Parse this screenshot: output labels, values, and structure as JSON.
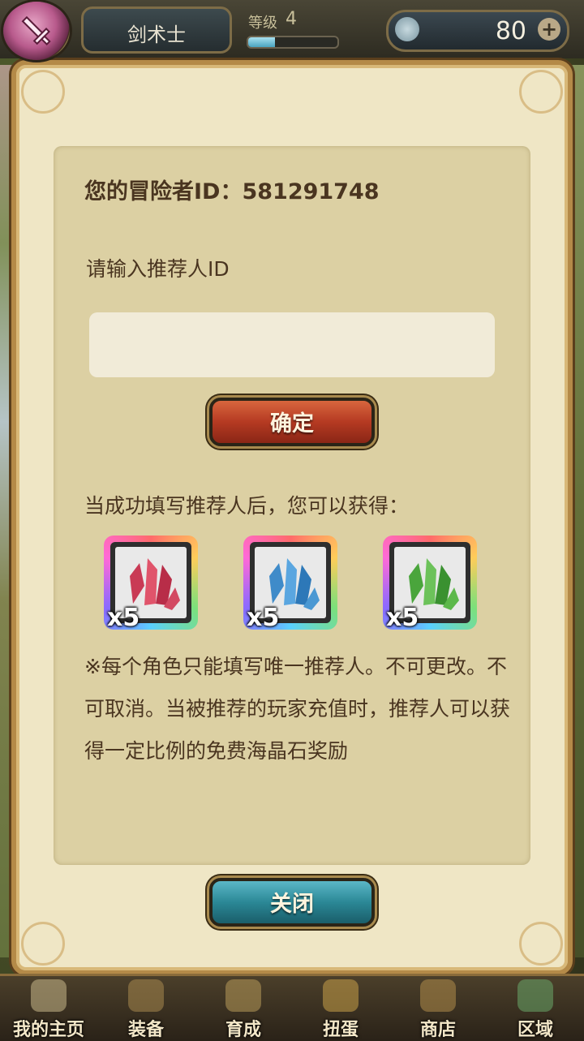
{
  "header": {
    "class_name": "剑术士",
    "level_label": "等级",
    "level_value": "4",
    "level_progress": 0.3,
    "gem_count": "80",
    "plus_symbol": "+"
  },
  "dialog": {
    "adventurer_id_line": "您的冒险者ID：581291748",
    "prompt": "请输入推荐人ID",
    "input_value": "",
    "confirm_label": "确定",
    "reward_title": "当成功填写推荐人后，您可以获得：",
    "rewards": [
      {
        "quantity": "x5",
        "icon": "red-crystal-icon",
        "color": "#d2405a"
      },
      {
        "quantity": "x5",
        "icon": "blue-crystal-icon",
        "color": "#4a9ad8"
      },
      {
        "quantity": "x5",
        "icon": "green-crystal-icon",
        "color": "#5cb84a"
      }
    ],
    "note": "※每个角色只能填写唯一推荐人。不可更改。不可取消。当被推荐的玩家充值时，推荐人可以获得一定比例的免费海晶石奖励",
    "close_label": "关闭"
  },
  "nav": {
    "items": [
      {
        "label": "我的主页",
        "icon": "scroll-icon"
      },
      {
        "label": "装备",
        "icon": "helmet-icon"
      },
      {
        "label": "育成",
        "icon": "sword-icon"
      },
      {
        "label": "扭蛋",
        "icon": "capsule-icon"
      },
      {
        "label": "商店",
        "icon": "bag-icon"
      },
      {
        "label": "区域",
        "icon": "globe-icon"
      }
    ]
  }
}
